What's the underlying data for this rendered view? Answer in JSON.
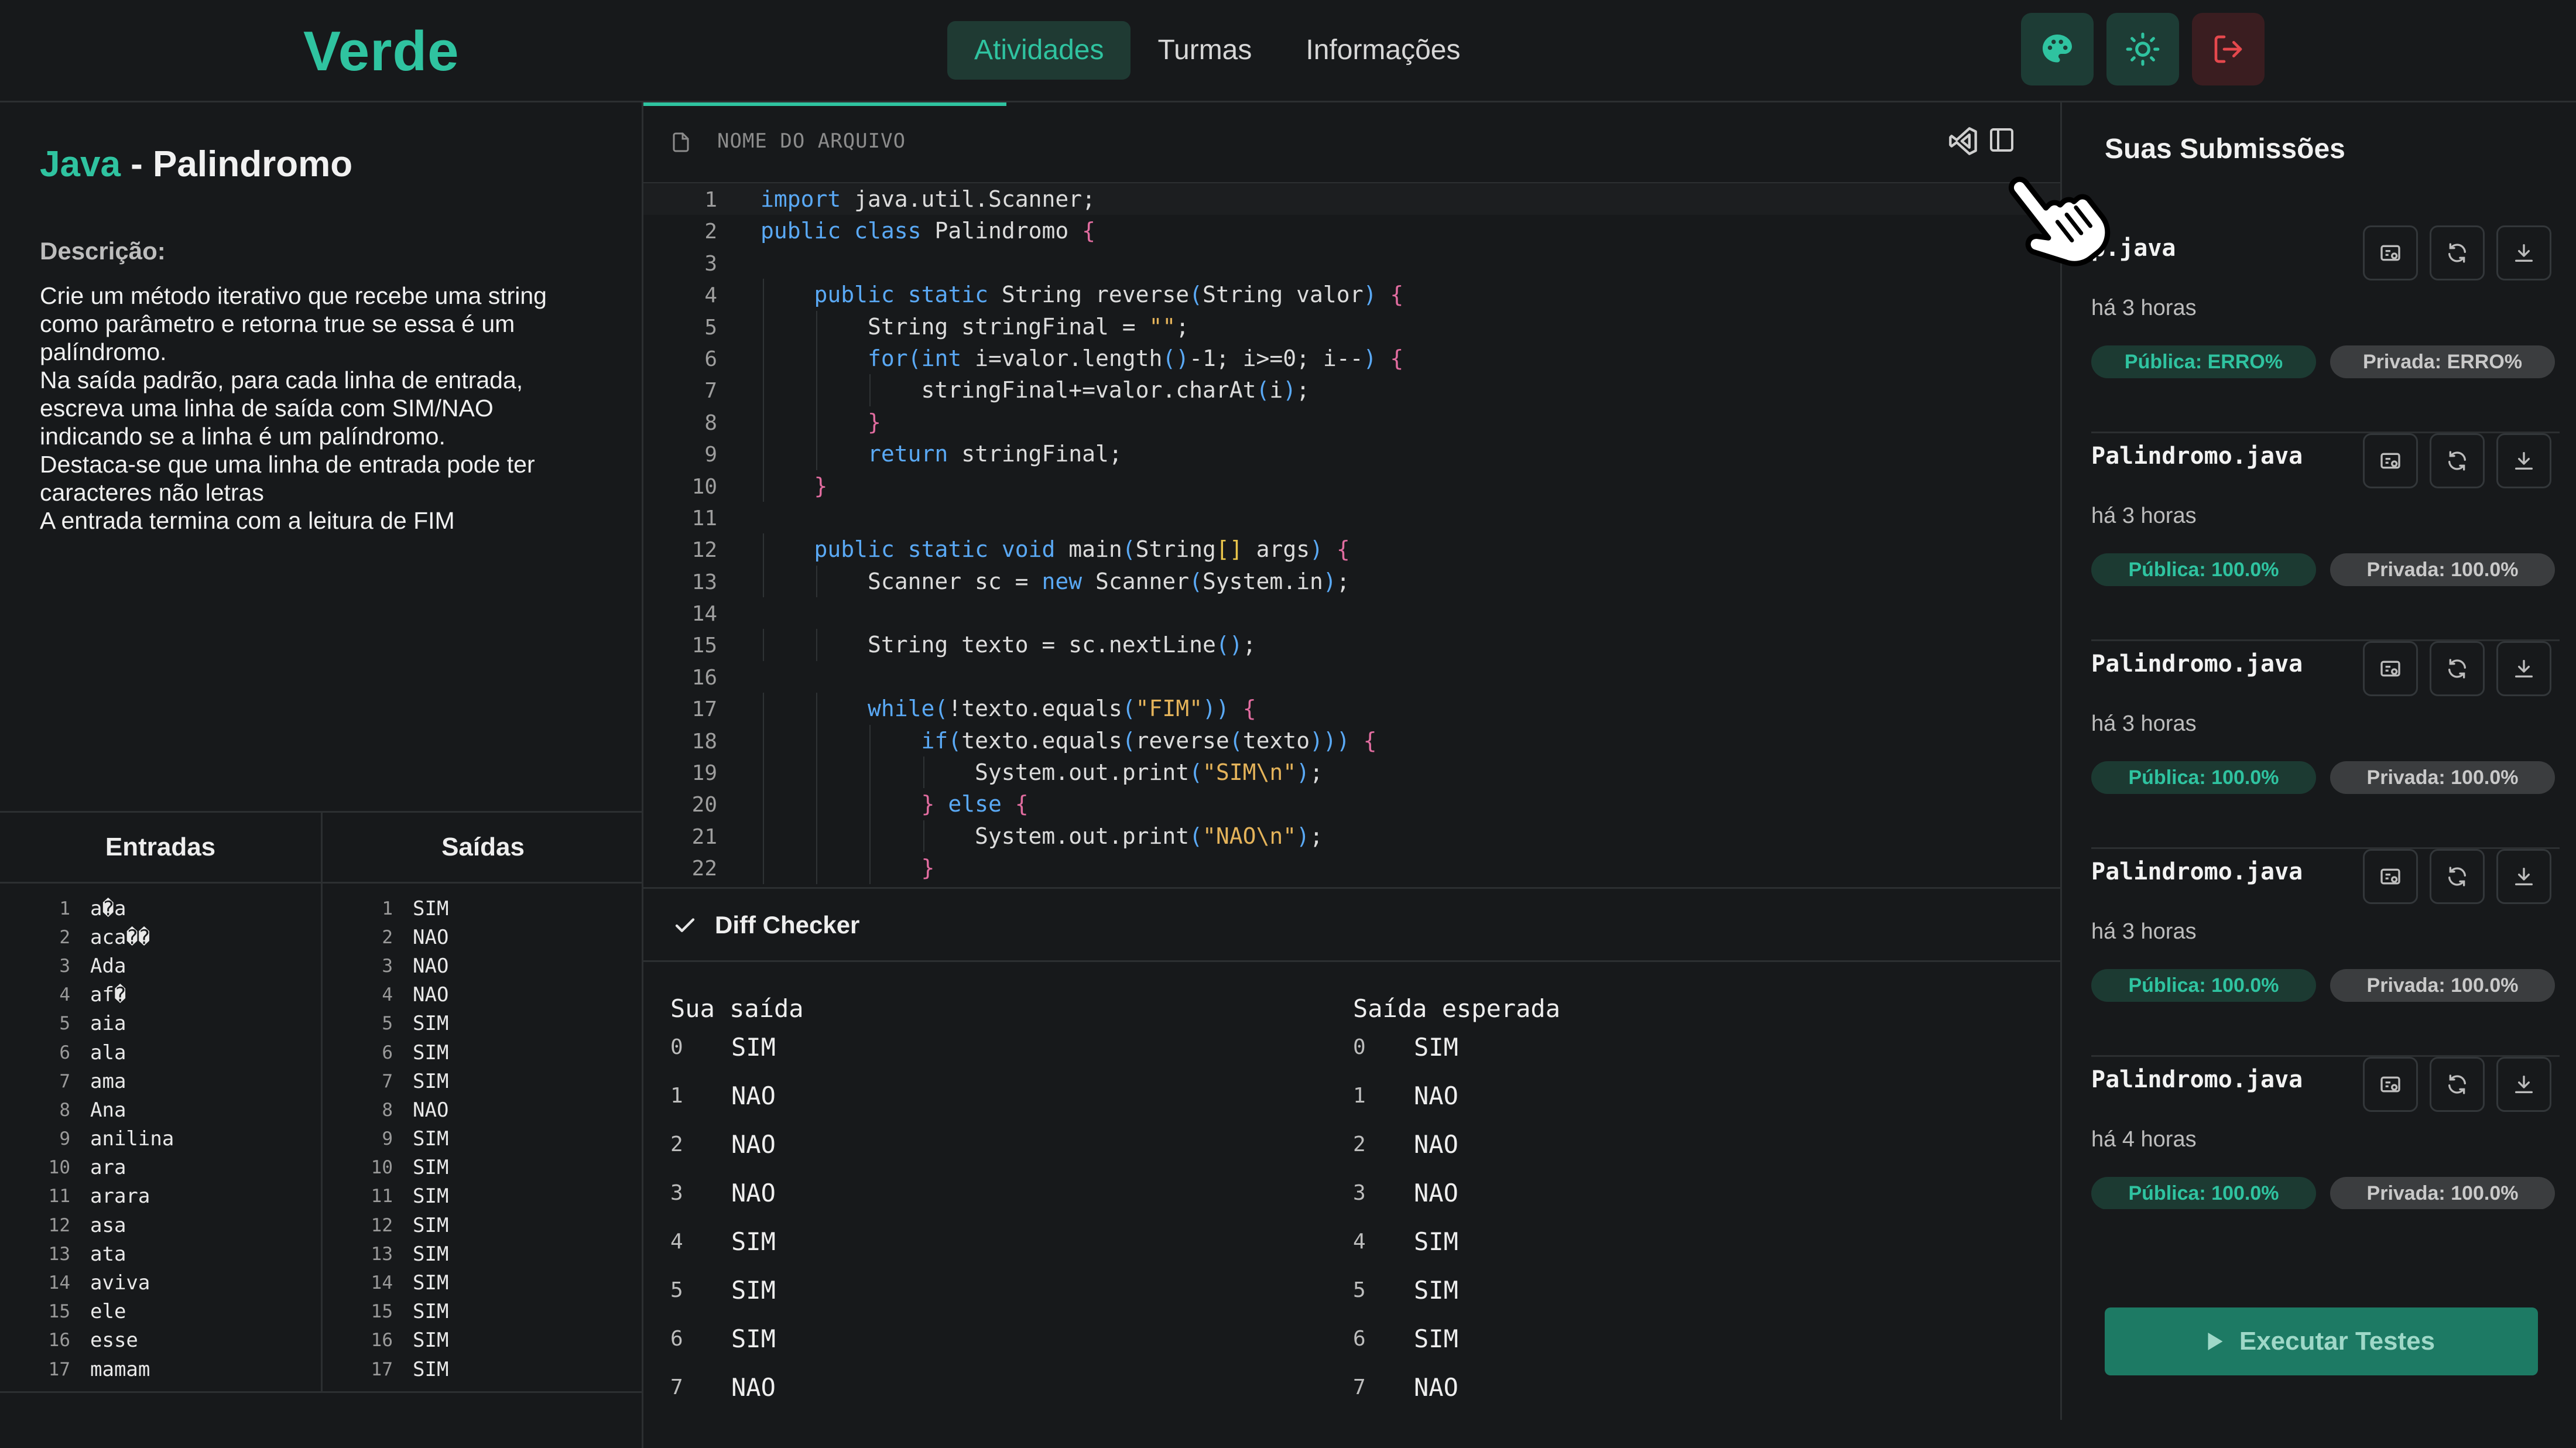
{
  "header": {
    "logo": "Verde",
    "nav": [
      {
        "label": "Atividades",
        "active": true
      },
      {
        "label": "Turmas",
        "active": false
      },
      {
        "label": "Informações",
        "active": false
      }
    ],
    "actions": [
      "palette-icon",
      "sun-icon",
      "logout-icon"
    ],
    "accent": "#2fc3a0"
  },
  "problem": {
    "language": "Java",
    "separator": " - ",
    "name": "Palindromo",
    "description_label": "Descrição:",
    "description": "Crie um método iterativo que recebe uma string\ncomo parâmetro e retorna true se essa é um\npalíndromo.\nNa saída padrão, para cada linha de entrada,\nescreva uma linha de saída com SIM/NAO\nindicando se a linha é um palíndromo.\nDestaca-se que uma linha de entrada pode ter\ncaracteres não letras\nA entrada termina com a leitura de FIM"
  },
  "io": {
    "inputs_label": "Entradas",
    "outputs_label": "Saídas",
    "inputs": [
      "a�a",
      "aca��",
      "Ada",
      "af�",
      "aia",
      "ala",
      "ama",
      "Ana",
      "anilina",
      "ara",
      "arara",
      "asa",
      "ata",
      "aviva",
      "ele",
      "esse",
      "mamam"
    ],
    "outputs": [
      "SIM",
      "NAO",
      "NAO",
      "NAO",
      "SIM",
      "SIM",
      "SIM",
      "NAO",
      "SIM",
      "SIM",
      "SIM",
      "SIM",
      "SIM",
      "SIM",
      "SIM",
      "SIM",
      "SIM"
    ]
  },
  "editor": {
    "filename_placeholder": "NOME DO ARQUIVO",
    "lines": [
      "import java.util.Scanner;",
      "public class Palindromo {",
      "",
      "    public static String reverse(String valor) {",
      "        String stringFinal = \"\";",
      "        for(int i=valor.length()-1; i>=0; i--) {",
      "            stringFinal+=valor.charAt(i);",
      "        }",
      "        return stringFinal;",
      "    }",
      "",
      "    public static void main(String[] args) {",
      "        Scanner sc = new Scanner(System.in);",
      "",
      "        String texto = sc.nextLine();",
      "",
      "        while(!texto.equals(\"FIM\")) {",
      "            if(texto.equals(reverse(texto))) {",
      "                System.out.print(\"SIM\\n\");",
      "            } else {",
      "                System.out.print(\"NAO\\n\");",
      "            }"
    ]
  },
  "diff": {
    "title": "Diff Checker",
    "your_output_label": "Sua saída",
    "expected_label": "Saída esperada",
    "your_output": [
      {
        "i": "0",
        "v": "SIM"
      },
      {
        "i": "1",
        "v": "NAO"
      },
      {
        "i": "2",
        "v": "NAO"
      },
      {
        "i": "3",
        "v": "NAO"
      },
      {
        "i": "4",
        "v": "SIM"
      },
      {
        "i": "5",
        "v": "SIM"
      },
      {
        "i": "6",
        "v": "SIM"
      },
      {
        "i": "7",
        "v": "NAO"
      }
    ],
    "expected": [
      {
        "i": "0",
        "v": "SIM"
      },
      {
        "i": "1",
        "v": "NAO"
      },
      {
        "i": "2",
        "v": "NAO"
      },
      {
        "i": "3",
        "v": "NAO"
      },
      {
        "i": "4",
        "v": "SIM"
      },
      {
        "i": "5",
        "v": "SIM"
      },
      {
        "i": "6",
        "v": "SIM"
      },
      {
        "i": "7",
        "v": "NAO"
      }
    ]
  },
  "submissions": {
    "title": "Suas Submissões",
    "items": [
      {
        "file": "p.java",
        "time": "há 3 horas",
        "public": "Pública: ERRO%",
        "private": "Privada: ERRO%"
      },
      {
        "file": "Palindromo.java",
        "time": "há 3 horas",
        "public": "Pública: 100.0%",
        "private": "Privada: 100.0%"
      },
      {
        "file": "Palindromo.java",
        "time": "há 3 horas",
        "public": "Pública: 100.0%",
        "private": "Privada: 100.0%"
      },
      {
        "file": "Palindromo.java",
        "time": "há 3 horas",
        "public": "Pública: 100.0%",
        "private": "Privada: 100.0%"
      },
      {
        "file": "Palindromo.java",
        "time": "há 4 horas",
        "public": "Pública: 100.0%",
        "private": "Privada: 100.0%"
      }
    ],
    "run_button": "Executar Testes"
  }
}
